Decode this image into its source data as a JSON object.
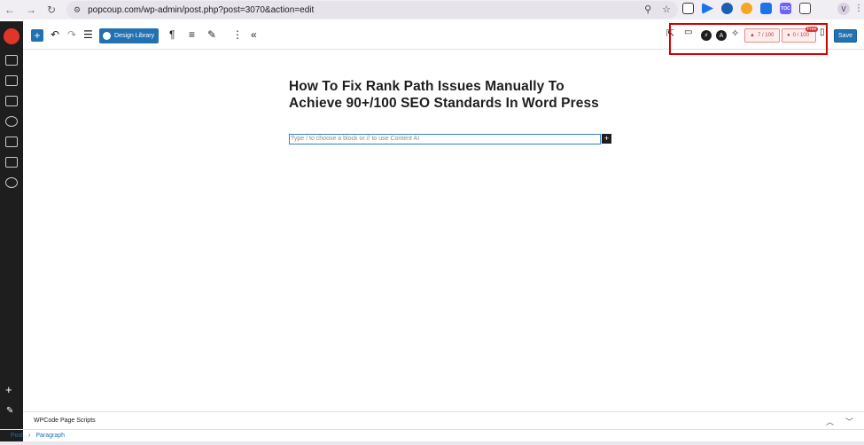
{
  "browser": {
    "url": "popcoup.com/wp-admin/post.php?post=3070&action=edit",
    "avatar_letter": "V",
    "ext_label": "TOC"
  },
  "toolbar": {
    "design_library_label": "Design Library",
    "seo_score": "7 / 100",
    "readability_score": "0 / 100",
    "free_tag": "Free",
    "save_label": "Save"
  },
  "editor": {
    "post_title": "How To Fix Rank Path Issues Manually To Achieve 90+/100 SEO Standards In Word Press",
    "paragraph_placeholder": "Type / to choose a block or // to use Content AI"
  },
  "footer": {
    "meta_box_title": "WPCode Page Scripts",
    "breadcrumb": [
      "Post",
      "Paragraph"
    ]
  },
  "colors": {
    "accent": "#2271b1",
    "highlight_box": "#d40000"
  }
}
